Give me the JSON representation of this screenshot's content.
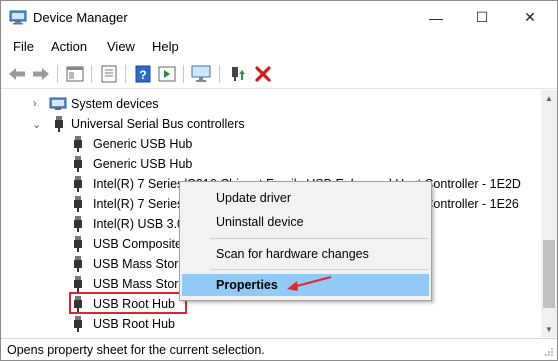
{
  "window": {
    "title": "Device Manager",
    "controls": {
      "minimize": "—",
      "maximize": "☐",
      "close": "✕"
    }
  },
  "menubar": {
    "items": [
      "File",
      "Action",
      "View",
      "Help"
    ]
  },
  "toolbar": {
    "buttons": [
      "back-icon",
      "forward-icon",
      "show-hide-console-tree-icon",
      "properties-icon",
      "help-icon",
      "run-action-icon",
      "update-driver-icon",
      "monitor-scan-icon",
      "enable-device-icon",
      "uninstall-icon"
    ]
  },
  "tree": {
    "rows": [
      {
        "label": "System devices",
        "expander": "›",
        "icon": "system-devices-icon"
      },
      {
        "label": "Universal Serial Bus controllers",
        "expander": "⌄",
        "icon": "usb-controller-icon"
      },
      {
        "label": "Generic USB Hub",
        "icon": "usb-plug-icon"
      },
      {
        "label": "Generic USB Hub",
        "icon": "usb-plug-icon"
      },
      {
        "label": "Intel(R) 7 Series/C216 Chipset Family USB Enhanced Host Controller - 1E2D",
        "icon": "usb-plug-icon"
      },
      {
        "label": "Intel(R) 7 Series/C216 Chipset Family USB Enhanced Host Controller - 1E26",
        "icon": "usb-plug-icon"
      },
      {
        "label": "Intel(R) USB 3.0 eXtensible Host Controller",
        "icon": "usb-plug-icon"
      },
      {
        "label": "USB Composite Device",
        "icon": "usb-plug-icon"
      },
      {
        "label": "USB Mass Storage Device",
        "icon": "usb-plug-icon"
      },
      {
        "label": "USB Mass Storage Device",
        "icon": "usb-plug-icon"
      },
      {
        "label": "USB Root Hub",
        "icon": "usb-plug-icon",
        "highlighted": true
      },
      {
        "label": "USB Root Hub",
        "icon": "usb-plug-icon"
      }
    ],
    "visible_clip": {
      "row4_tail": "- 1E2D",
      "row5_tail": "- 1E26"
    }
  },
  "context_menu": {
    "items": [
      {
        "label": "Update driver"
      },
      {
        "label": "Uninstall device"
      },
      {
        "label": "Scan for hardware changes"
      },
      {
        "label": "Properties",
        "selected": true,
        "bold": true
      }
    ]
  },
  "statusbar": {
    "text": "Opens property sheet for the current selection."
  },
  "colors": {
    "selection": "#91c9f7",
    "highlight_border": "#d9262c",
    "arrow": "#e0282e",
    "menu_bg": "#f2f2f2"
  }
}
